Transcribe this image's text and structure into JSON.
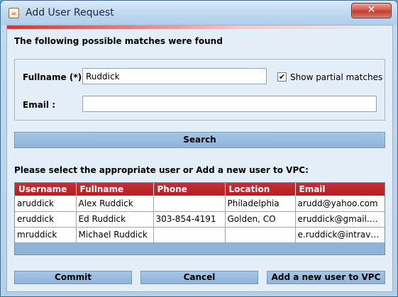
{
  "window": {
    "title": "Add User Request",
    "app_icon": "java-icon",
    "close_glyph": "✕"
  },
  "header": {
    "matches_label": "The following possible matches were found"
  },
  "form": {
    "fullname_label": "Fullname (*) :",
    "fullname_value": "Ruddick",
    "email_label": "Email :",
    "email_value": "",
    "partial_checkbox_checked": true,
    "partial_checkbox_glyph": "✔",
    "partial_label": "Show partial matches"
  },
  "search": {
    "button_label": "Search"
  },
  "results": {
    "prompt": "Please select the appropriate user or Add a new user to VPC:",
    "columns": [
      "Username",
      "Fullname",
      "Phone",
      "Location",
      "Email"
    ],
    "rows": [
      [
        "aruddick",
        "Alex Ruddick",
        "",
        "Philadelphia",
        "arudd@yahoo.com"
      ],
      [
        "eruddick",
        "Ed Ruddick",
        "303-854-4191",
        "Golden, CO",
        "eruddick@gmail.com"
      ],
      [
        "mruddick",
        "Michael Ruddick",
        "",
        "",
        "e.ruddick@intravatio..."
      ]
    ]
  },
  "actions": {
    "commit": "Commit",
    "cancel": "Cancel",
    "add_new": "Add a new user to VPC"
  },
  "colors": {
    "table_header": "#b21e22",
    "button_blue": "#8fb3d9",
    "title_close": "#c23d30"
  }
}
